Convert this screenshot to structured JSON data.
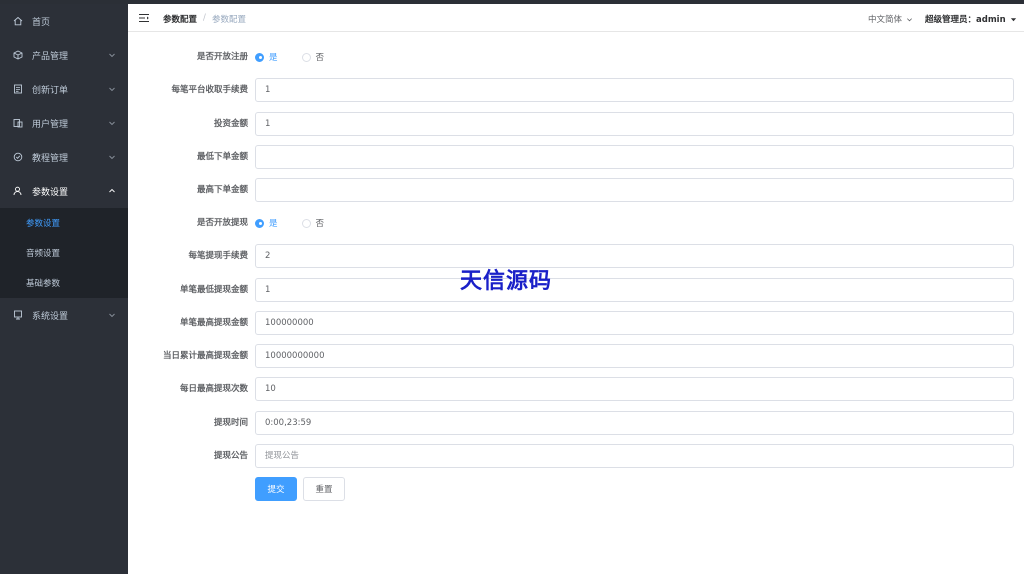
{
  "sidebar": {
    "items": [
      {
        "label": "首页",
        "icon": "home-icon",
        "has_arrow": false
      },
      {
        "label": "产品管理",
        "icon": "cube-icon",
        "has_arrow": true
      },
      {
        "label": "创新订单",
        "icon": "order-icon",
        "has_arrow": true
      },
      {
        "label": "用户管理",
        "icon": "users-icon",
        "has_arrow": true
      },
      {
        "label": "教程管理",
        "icon": "tutorial-icon",
        "has_arrow": true
      },
      {
        "label": "参数设置",
        "icon": "user-settings-icon",
        "has_arrow": true,
        "expanded": true
      },
      {
        "label": "系统设置",
        "icon": "system-icon",
        "has_arrow": true
      }
    ],
    "submenu": [
      {
        "label": "参数设置",
        "active": true
      },
      {
        "label": "音频设置",
        "active": false
      },
      {
        "label": "基础参数",
        "active": false
      }
    ]
  },
  "header": {
    "breadcrumb_root": "参数配置",
    "breadcrumb_separator": "/",
    "breadcrumb_current": "参数配置",
    "language": "中文简体",
    "admin_label": "超级管理员：admin"
  },
  "form": {
    "register_open_label": "是否开放注册",
    "register_yes": "是",
    "register_no": "否",
    "fee_per_order_label": "每笔平台收取手续费",
    "fee_per_order_value": "1",
    "invest_amount_label": "投资金额",
    "invest_amount_value": "1",
    "min_order_label": "最低下单金额",
    "min_order_value": "",
    "max_order_label": "最高下单金额",
    "max_order_value": "",
    "withdraw_open_label": "是否开放提现",
    "withdraw_yes": "是",
    "withdraw_no": "否",
    "withdraw_fee_label": "每笔提现手续费",
    "withdraw_fee_value": "2",
    "min_withdraw_label": "单笔最低提现金额",
    "min_withdraw_value": "1",
    "max_withdraw_label": "单笔最高提现金额",
    "max_withdraw_value": "100000000",
    "daily_max_label": "当日累计最高提现金额",
    "daily_max_value": "10000000000",
    "daily_times_label": "每日最高提现次数",
    "daily_times_value": "10",
    "withdraw_time_label": "提现时间",
    "withdraw_time_value": "0:00,23:59",
    "notice_label": "提现公告",
    "notice_placeholder": "提现公告",
    "submit_label": "提交",
    "reset_label": "重置"
  },
  "watermark": "天信源码",
  "colors": {
    "sidebar_bg": "#2c3038",
    "submenu_bg": "#1f2329",
    "accent": "#409eff",
    "watermark": "#1a20c8"
  }
}
